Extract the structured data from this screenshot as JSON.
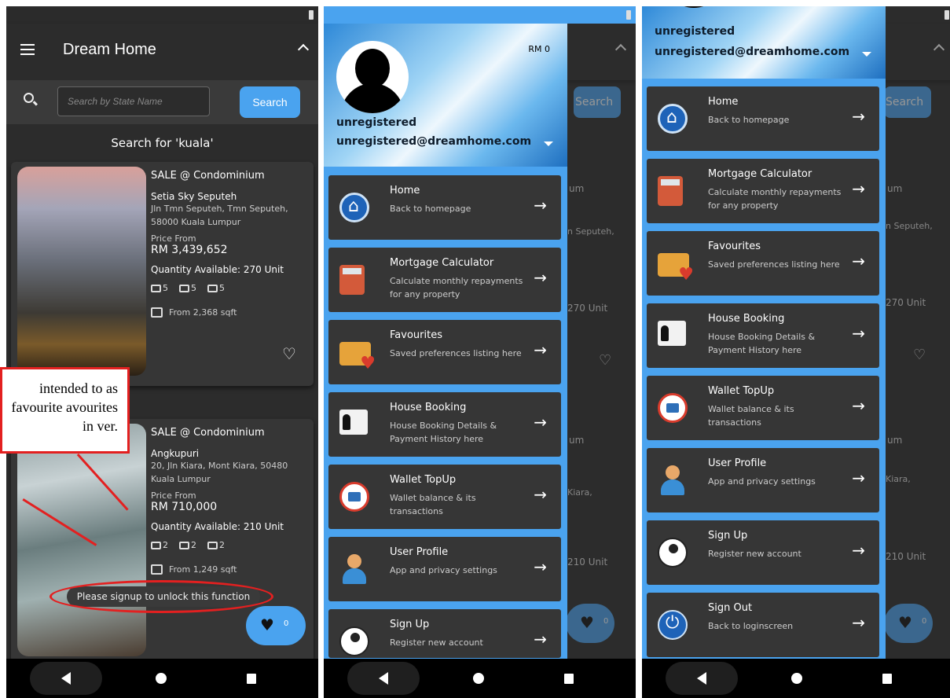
{
  "app": {
    "title": "Dream Home"
  },
  "search": {
    "placeholder": "Search by State Name",
    "button": "Search",
    "heading": "Search for 'kuala'"
  },
  "listings": [
    {
      "type": "SALE @ Condominium",
      "name": "Setia Sky Seputeh",
      "address": "Jln Tmn Seputeh, Tmn Seputeh, 58000 Kuala Lumpur",
      "price_label": "Price From",
      "price": "RM 3,439,652",
      "quantity": "Quantity Available: 270 Unit",
      "rooms": "5",
      "baths": "5",
      "parking": "5",
      "area": "From 2,368 sqft"
    },
    {
      "type": "SALE @ Condominium",
      "name": "Angkupuri",
      "address": "20, Jln Kiara, Mont Kiara, 50480 Kuala Lumpur",
      "price_label": "Price From",
      "price": "RM 710,000",
      "quantity": "Quantity Available: 210 Unit",
      "rooms": "2",
      "baths": "2",
      "parking": "2",
      "area": "From 1,249 sqft"
    }
  ],
  "toast": "Please signup to unlock this function",
  "fab": {
    "count": "0"
  },
  "callout": {
    "text": "intended to as favourite avourites in ver."
  },
  "drawer": {
    "balance": "RM 0",
    "user_name": "unregistered",
    "user_email": "unregistered@dreamhome.com",
    "items_guest": [
      {
        "title": "Home",
        "subtitle": "Back to homepage",
        "icon": "home-icon"
      },
      {
        "title": "Mortgage Calculator",
        "subtitle": "Calculate monthly repayments for any property",
        "icon": "calculator-icon"
      },
      {
        "title": "Favourites",
        "subtitle": "Saved preferences listing here",
        "icon": "folder-heart-icon"
      },
      {
        "title": "House Booking",
        "subtitle": "House Booking Details & Payment History here",
        "icon": "booking-icon"
      },
      {
        "title": "Wallet TopUp",
        "subtitle": "Wallet balance & its transactions",
        "icon": "wallet-icon"
      },
      {
        "title": "User Profile",
        "subtitle": "App and privacy settings",
        "icon": "user-icon"
      },
      {
        "title": "Sign Up",
        "subtitle": "Register new account",
        "icon": "signup-icon"
      }
    ],
    "items_scrolled": [
      {
        "title": "Home",
        "subtitle": "Back to homepage",
        "icon": "home-icon"
      },
      {
        "title": "Mortgage Calculator",
        "subtitle": "Calculate monthly repayments for any property",
        "icon": "calculator-icon"
      },
      {
        "title": "Favourites",
        "subtitle": "Saved preferences listing here",
        "icon": "folder-heart-icon"
      },
      {
        "title": "House Booking",
        "subtitle": "House Booking Details & Payment History here",
        "icon": "booking-icon"
      },
      {
        "title": "Wallet TopUp",
        "subtitle": "Wallet balance & its transactions",
        "icon": "wallet-icon"
      },
      {
        "title": "User Profile",
        "subtitle": "App and privacy settings",
        "icon": "user-icon"
      },
      {
        "title": "Sign Up",
        "subtitle": "Register new account",
        "icon": "signup-icon"
      },
      {
        "title": "Sign Out",
        "subtitle": "Back to loginscreen",
        "icon": "power-icon"
      }
    ]
  },
  "behind": {
    "search_btn": "Search",
    "frag1": "um",
    "frag2": "n Seputeh,",
    "frag3": "270 Unit",
    "frag4": "um",
    "frag5": "Kiara,",
    "frag6": "210 Unit",
    "frag7": "um",
    "frag8": "n Seputeh,",
    "frag9": "270 Unit",
    "frag10": "um",
    "frag11": "Kiara,",
    "frag12": "210 Unit"
  },
  "colors": {
    "accent": "#4aa3ef",
    "surface": "#363636",
    "background": "#2c2c2c",
    "annotation": "#e32020"
  }
}
